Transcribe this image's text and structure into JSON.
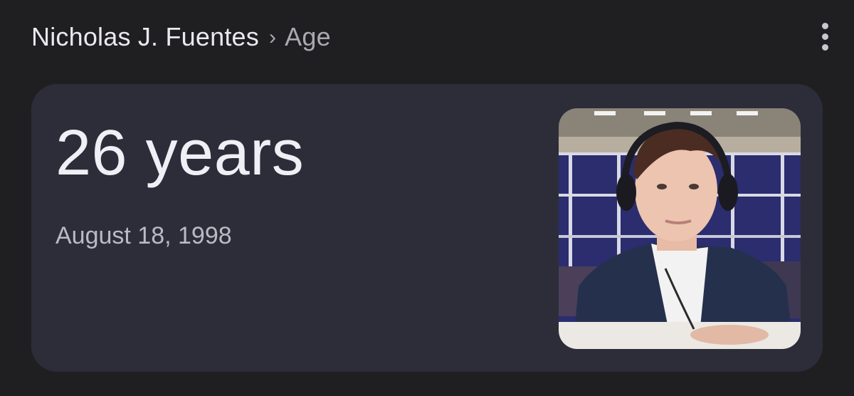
{
  "breadcrumb": {
    "subject": "Nicholas J. Fuentes",
    "separator": "›",
    "attribute": "Age"
  },
  "menu": {
    "icon": "more-vert-icon"
  },
  "answer_card": {
    "age": "26 years",
    "birth_date": "August 18, 1998",
    "photo_icon": "person-photo"
  },
  "colors": {
    "background": "#1f1f21",
    "card": "#2c2d38",
    "primary_text": "#eff0f6",
    "secondary_text": "#b9bac4"
  }
}
